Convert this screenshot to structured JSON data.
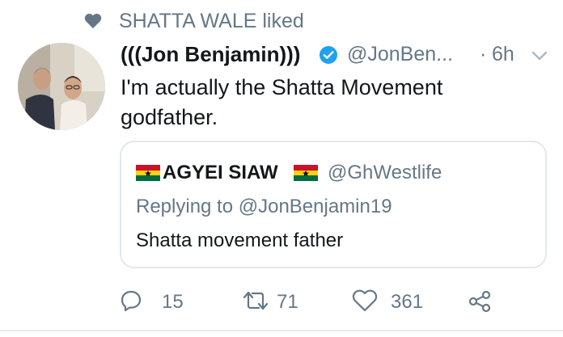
{
  "context": {
    "label": "SHATTA WALE liked",
    "icon": "heart-icon"
  },
  "tweet": {
    "display_name": "(((Jon Benjamin)))",
    "handle": "@JonBen...",
    "separator": "·",
    "time": "6h",
    "text": "I'm actually the Shatta Movement godfather."
  },
  "quote": {
    "display_name": "AGYEI SIAW",
    "handle": "@GhWestlife",
    "replying_to": "Replying to @JonBenjamin19",
    "text": "Shatta movement father"
  },
  "actions": {
    "reply_count": "15",
    "retweet_count": "71",
    "like_count": "361"
  },
  "colors": {
    "text": "#14171a",
    "secondary": "#657786",
    "verified": "#1da1f2",
    "border": "#e1e8ed"
  }
}
